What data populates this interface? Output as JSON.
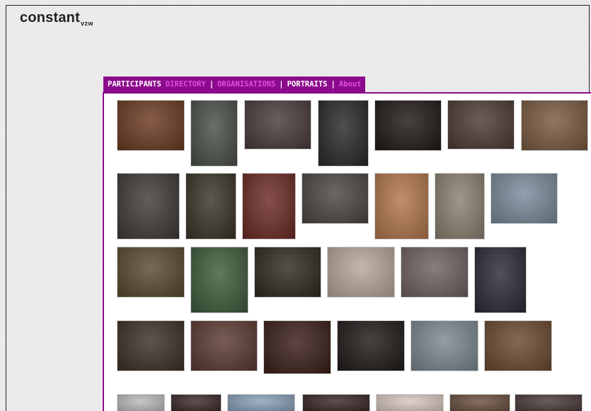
{
  "site": {
    "name": "constant",
    "suffix": "vzw"
  },
  "nav": {
    "participants": "PARTICIPANTS",
    "directory": "DIRECTORY",
    "sep1": "|",
    "organisations": "ORGANISATIONS",
    "sep2": "|",
    "portraits": "PORTRAITS",
    "sep3": "|",
    "about": "About"
  },
  "photo_colors": [
    "#6b3a22",
    "#4a4f48",
    "#4a3a3a",
    "#2a2727",
    "#1f1815",
    "#4d3a35",
    "#7a5a40",
    "#3f3a36",
    "#3a3327",
    "#6b2a24",
    "#4a4642",
    "#b2764a",
    "#8a8070",
    "#7a8a9a",
    "#5a4a2e",
    "#3e5a3a",
    "#2e2a20",
    "#b8a698",
    "#706060",
    "#2a2a36",
    "#3b3028",
    "#5a3a30",
    "#3a1e18",
    "#1e1a18",
    "#7a8890",
    "#6a4a30",
    "#bbbbbb",
    "#3a2a28",
    "#8aa0b8",
    "#3a2828",
    "#d8c8c0",
    "#6a5040",
    "#4a3a3a"
  ]
}
